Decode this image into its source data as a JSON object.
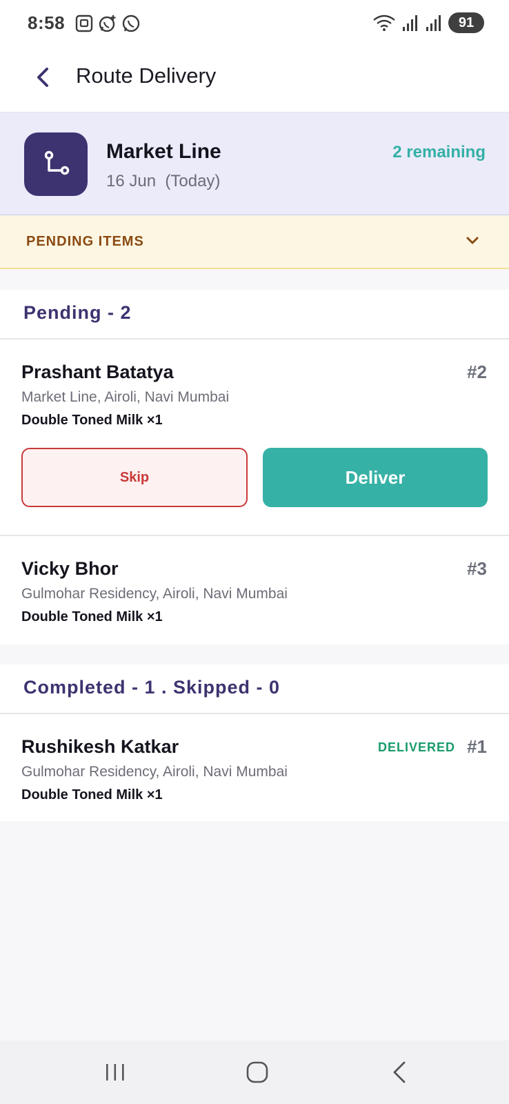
{
  "status_bar": {
    "time": "8:58",
    "battery": "91",
    "left_icons": [
      "screenshot-icon",
      "whatsapp-business-icon",
      "whatsapp-icon"
    ],
    "right_icons": [
      "wifi-icon",
      "signal-icon",
      "signal-icon"
    ]
  },
  "app_bar": {
    "title": "Route Delivery"
  },
  "route": {
    "name": "Market Line",
    "date": "16 Jun  (Today)",
    "remaining": "2 remaining"
  },
  "pending_items": {
    "label": "PENDING ITEMS"
  },
  "pending_section": {
    "title": "Pending - 2",
    "customers": [
      {
        "name": "Prashant Batatya",
        "address": "Market Line, Airoli, Navi Mumbai",
        "item": "Double Toned Milk ×1",
        "number": "#2",
        "skip_label": "Skip",
        "deliver_label": "Deliver"
      },
      {
        "name": "Vicky Bhor",
        "address": "Gulmohar Residency, Airoli, Navi Mumbai",
        "item": "Double Toned Milk ×1",
        "number": "#3"
      }
    ]
  },
  "completed_section": {
    "title": "Completed - 1 . Skipped - 0",
    "customers": [
      {
        "name": "Rushikesh Katkar",
        "address": "Gulmohar Residency, Airoli, Navi Mumbai",
        "item": "Double Toned Milk ×1",
        "status": "DELIVERED",
        "number": "#1"
      }
    ]
  },
  "colors": {
    "brand": "#3d3370",
    "accent": "#36b1a6",
    "skip": "#c93838",
    "delivered": "#1a9b6a",
    "pending_banner": "#fdf6e3"
  }
}
